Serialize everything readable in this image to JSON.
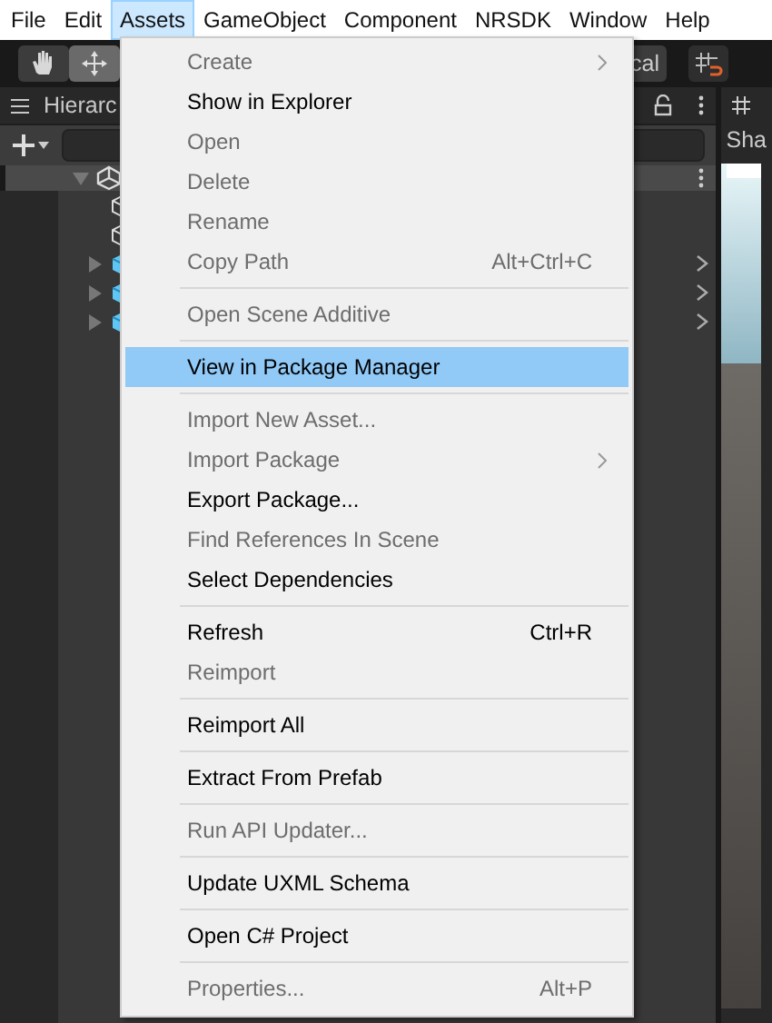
{
  "menubar": [
    {
      "label": "File",
      "selected": false
    },
    {
      "label": "Edit",
      "selected": false
    },
    {
      "label": "Assets",
      "selected": true
    },
    {
      "label": "GameObject",
      "selected": false
    },
    {
      "label": "Component",
      "selected": false
    },
    {
      "label": "NRSDK",
      "selected": false
    },
    {
      "label": "Window",
      "selected": false
    },
    {
      "label": "Help",
      "selected": false
    }
  ],
  "toolbar": {
    "partial_label": "cal"
  },
  "hierarchy": {
    "title": "Hierarc",
    "rows": [
      {
        "kind": "scene",
        "expanded": true
      },
      {
        "kind": "object"
      },
      {
        "kind": "object"
      },
      {
        "kind": "prefab",
        "expanded": false
      },
      {
        "kind": "prefab",
        "expanded": false
      },
      {
        "kind": "prefab",
        "expanded": false
      }
    ]
  },
  "scene_panel": {
    "tab_label": "Sha"
  },
  "menu": [
    {
      "kind": "item",
      "label": "Create",
      "disabled": true,
      "submenu": true,
      "selected": false
    },
    {
      "kind": "item",
      "label": "Show in Explorer",
      "disabled": false,
      "selected": false
    },
    {
      "kind": "item",
      "label": "Open",
      "disabled": true,
      "selected": false
    },
    {
      "kind": "item",
      "label": "Delete",
      "disabled": true,
      "selected": false
    },
    {
      "kind": "item",
      "label": "Rename",
      "disabled": true,
      "selected": false
    },
    {
      "kind": "item",
      "label": "Copy Path",
      "disabled": true,
      "shortcut": "Alt+Ctrl+C",
      "selected": false
    },
    {
      "kind": "separator"
    },
    {
      "kind": "item",
      "label": "Open Scene Additive",
      "disabled": true,
      "selected": false
    },
    {
      "kind": "separator"
    },
    {
      "kind": "item",
      "label": "View in Package Manager",
      "disabled": false,
      "selected": true
    },
    {
      "kind": "separator"
    },
    {
      "kind": "item",
      "label": "Import New Asset...",
      "disabled": true,
      "selected": false
    },
    {
      "kind": "item",
      "label": "Import Package",
      "disabled": true,
      "submenu": true,
      "selected": false
    },
    {
      "kind": "item",
      "label": "Export Package...",
      "disabled": false,
      "selected": false
    },
    {
      "kind": "item",
      "label": "Find References In Scene",
      "disabled": true,
      "selected": false
    },
    {
      "kind": "item",
      "label": "Select Dependencies",
      "disabled": false,
      "selected": false
    },
    {
      "kind": "separator"
    },
    {
      "kind": "item",
      "label": "Refresh",
      "disabled": false,
      "shortcut": "Ctrl+R",
      "selected": false
    },
    {
      "kind": "item",
      "label": "Reimport",
      "disabled": true,
      "selected": false
    },
    {
      "kind": "separator"
    },
    {
      "kind": "item",
      "label": "Reimport All",
      "disabled": false,
      "selected": false
    },
    {
      "kind": "separator"
    },
    {
      "kind": "item",
      "label": "Extract From Prefab",
      "disabled": false,
      "selected": false
    },
    {
      "kind": "separator"
    },
    {
      "kind": "item",
      "label": "Run API Updater...",
      "disabled": true,
      "selected": false
    },
    {
      "kind": "separator"
    },
    {
      "kind": "item",
      "label": "Update UXML Schema",
      "disabled": false,
      "selected": false
    },
    {
      "kind": "separator"
    },
    {
      "kind": "item",
      "label": "Open C# Project",
      "disabled": false,
      "selected": false
    },
    {
      "kind": "separator"
    },
    {
      "kind": "item",
      "label": "Properties...",
      "disabled": true,
      "shortcut": "Alt+P",
      "selected": false
    }
  ]
}
